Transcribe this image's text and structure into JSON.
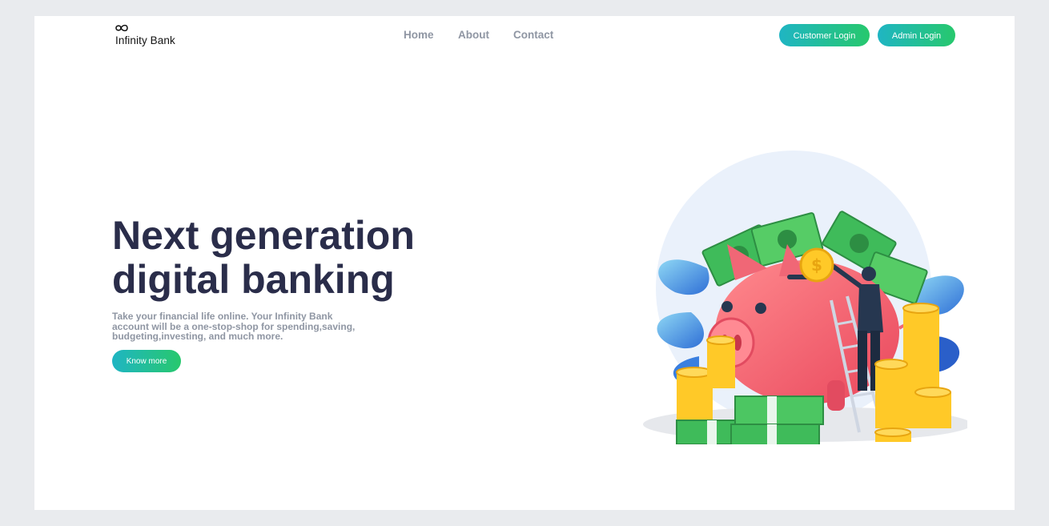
{
  "brand": {
    "name": "Infinity Bank",
    "logo_icon": "infinity-icon"
  },
  "nav": {
    "items": [
      {
        "label": "Home"
      },
      {
        "label": "About"
      },
      {
        "label": "Contact"
      }
    ]
  },
  "header_buttons": {
    "customer_login": "Customer Login",
    "admin_login": "Admin Login"
  },
  "hero": {
    "title_line1": "Next generation",
    "title_line2": "digital banking",
    "description": "Take your financial life online. Your Infinity Bank account will be a one-stop-shop for spending,saving, budgeting,investing, and much more.",
    "cta_label": "Know more"
  },
  "colors": {
    "page_background": "#e9ebee",
    "card_background": "#ffffff",
    "heading": "#2a2d4a",
    "muted_text": "#8f96a3",
    "gradient_start": "#1fb5c3",
    "gradient_end": "#27c86d"
  },
  "illustration": {
    "subject": "piggy-bank-illustration"
  }
}
